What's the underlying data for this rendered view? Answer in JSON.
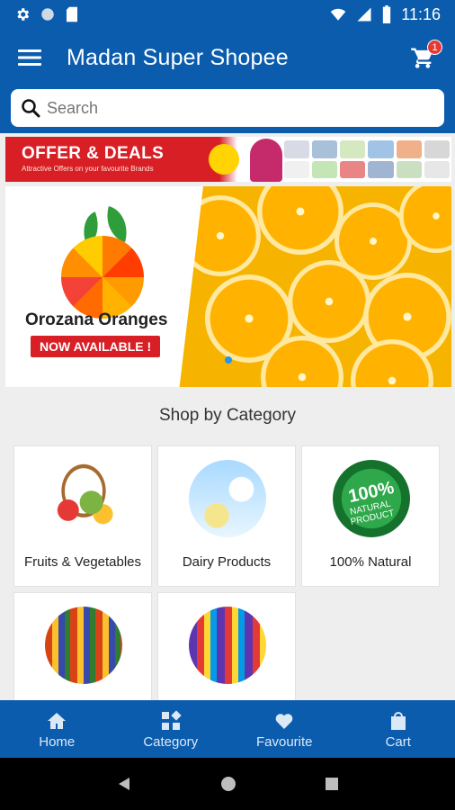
{
  "status": {
    "time": "11:16"
  },
  "app_bar": {
    "title": "Madan Super Shopee",
    "cart_count": "1",
    "icons": [
      "menu-icon",
      "cart-icon"
    ]
  },
  "search": {
    "placeholder": "Search"
  },
  "offer_banner": {
    "title": "OFFER & DEALS",
    "subtitle": "Attractive Offers on your favourite Brands"
  },
  "hero": {
    "brand": "Orozana Oranges",
    "badge": "NOW AVAILABLE !"
  },
  "section": {
    "title": "Shop by Category"
  },
  "categories": [
    {
      "label": "Fruits & Vegetables"
    },
    {
      "label": "Dairy Products"
    },
    {
      "label": "100% Natural",
      "image_text": "100%",
      "image_sub": "NATURAL PRODUCT"
    },
    {
      "label": ""
    },
    {
      "label": ""
    }
  ],
  "bottom_nav": [
    {
      "label": "Home",
      "icon": "home-icon"
    },
    {
      "label": "Category",
      "icon": "category-icon"
    },
    {
      "label": "Favourite",
      "icon": "heart-icon"
    },
    {
      "label": "Cart",
      "icon": "bag-icon"
    }
  ],
  "colors": {
    "primary": "#0b5cad",
    "accent_red": "#d81f26",
    "background": "#eeeeee"
  }
}
